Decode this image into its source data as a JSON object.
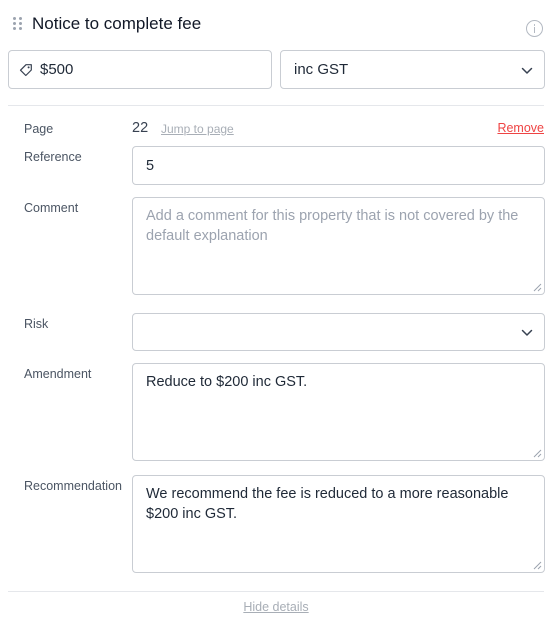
{
  "header": {
    "title": "Notice to complete fee",
    "info_icon": "info-circle-icon",
    "drag_icon": "drag-handle-icon"
  },
  "amount": {
    "icon": "tag-icon",
    "value": "$500"
  },
  "gst": {
    "selected": "inc GST",
    "icon": "chevron-down-icon"
  },
  "details": {
    "page": {
      "label": "Page",
      "value": "22",
      "jump_label": "Jump to page",
      "remove_label": "Remove"
    },
    "reference": {
      "label": "Reference",
      "value": "5"
    },
    "comment": {
      "label": "Comment",
      "placeholder": "Add a comment for this property that is not covered by the default explanation"
    },
    "risk": {
      "label": "Risk",
      "value": ""
    },
    "amendment": {
      "label": "Amendment",
      "value": "Reduce to $200 inc GST."
    },
    "recommendation": {
      "label": "Recommendation",
      "value": "We recommend the fee is reduced to a more reasonable $200 inc GST."
    }
  },
  "footer": {
    "hide_label": "Hide details"
  },
  "colors": {
    "remove": "#ef4444",
    "muted_link": "#a8aeb6",
    "border": "#c9cdd3"
  }
}
